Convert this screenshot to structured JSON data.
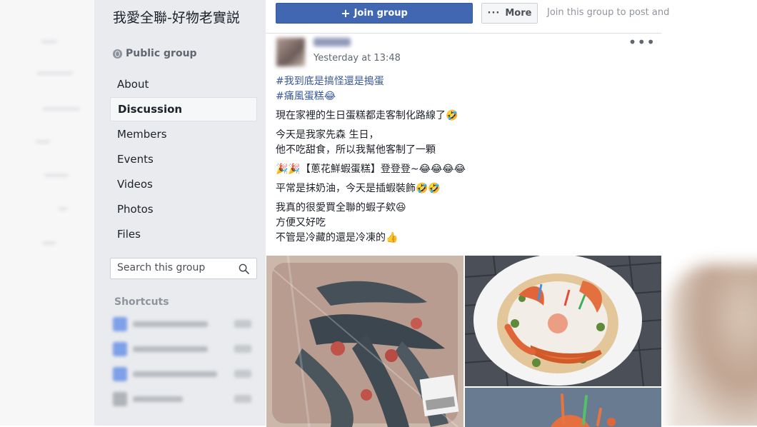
{
  "sidebar": {
    "group_title": "我愛全聯-好物老實説",
    "privacy": "Public group",
    "nav_items": [
      {
        "label": "About",
        "active": false
      },
      {
        "label": "Discussion",
        "active": true
      },
      {
        "label": "Members",
        "active": false
      },
      {
        "label": "Events",
        "active": false
      },
      {
        "label": "Videos",
        "active": false
      },
      {
        "label": "Photos",
        "active": false
      },
      {
        "label": "Files",
        "active": false
      }
    ],
    "search_placeholder": "Search this group",
    "shortcuts_title": "Shortcuts"
  },
  "topbar": {
    "join_label": "Join group",
    "more_label": "More",
    "join_hint": "Join this group to post and"
  },
  "post": {
    "timestamp": "Yesterday at 13:48",
    "options_icon": "•••",
    "lines": [
      "#我到底是搞怪還是搗蛋",
      "#痛風蛋糕😂",
      "現在家裡的生日蛋糕都走客制化路線了🤣",
      "今天是我家先森 生日，",
      "他不吃甜食，所以我幫他客制了一顆",
      "🎉🎉【蔥花鮮蝦蛋糕】登登登~😂😂😂😂",
      "平常是抹奶油，今天是插蝦裝飾🤣🤣",
      "我真的很愛買全聯的蝦子欸😆",
      "方便又好吃",
      "不管是冷藏的還是冷凍的👍"
    ]
  },
  "colors": {
    "brand_blue": "#4267b2",
    "sidebar_bg": "#e9ebee",
    "hashtag": "#385898"
  }
}
